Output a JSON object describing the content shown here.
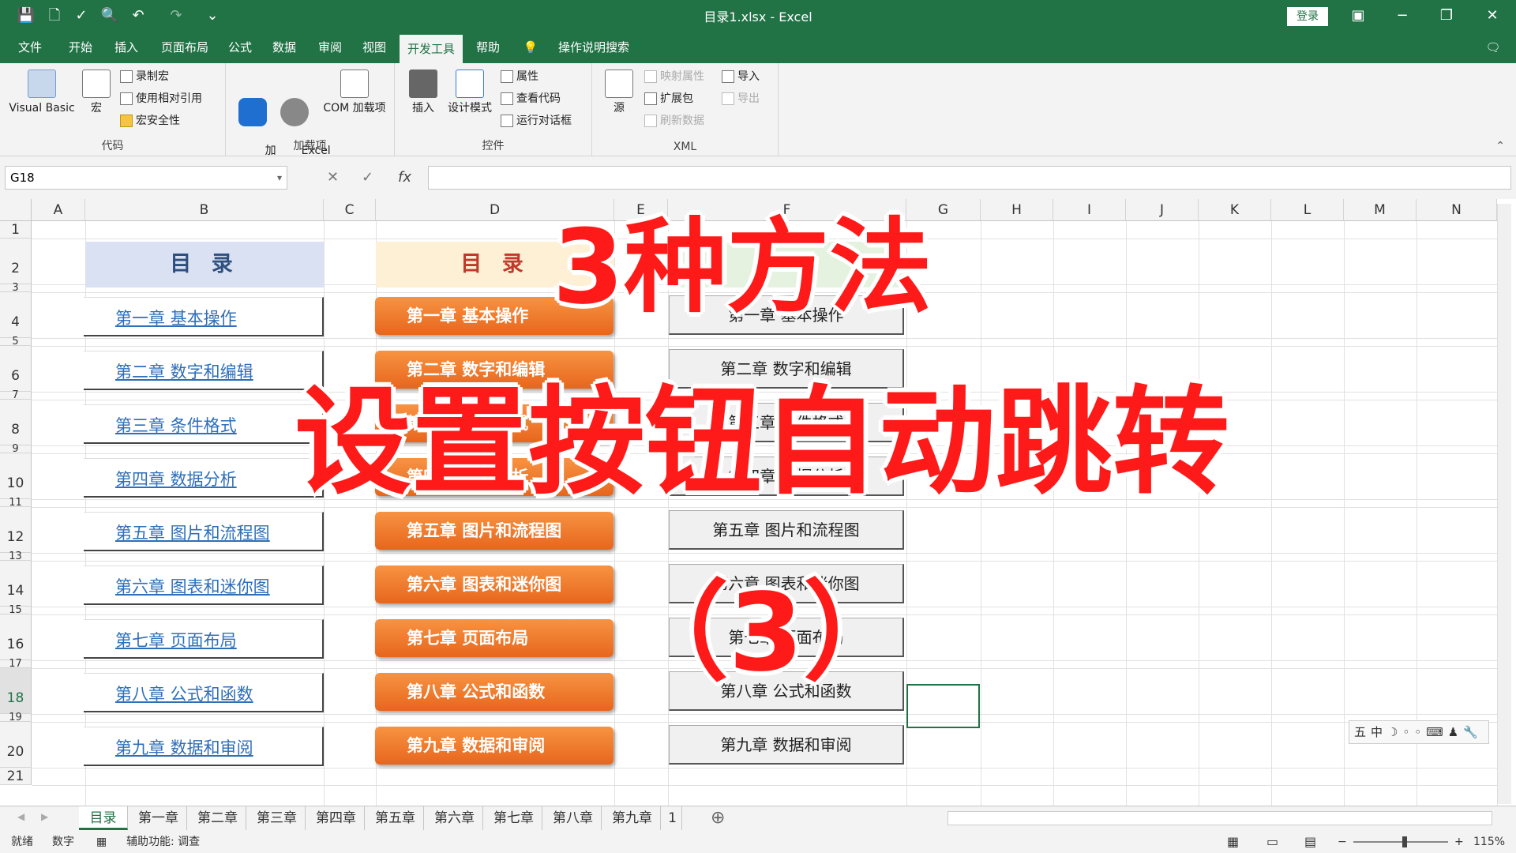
{
  "window": {
    "title": "目录1.xlsx - Excel",
    "login": "登录",
    "min": "−",
    "restore": "❐",
    "close": "✕",
    "ribbon_display": "▣"
  },
  "quick_access": [
    "💾",
    "🗋",
    "✓",
    "🔍",
    "↶",
    "↷",
    "⌄"
  ],
  "menu": {
    "file": "文件",
    "home": "开始",
    "insert": "插入",
    "layout": "页面布局",
    "formula": "公式",
    "data": "数据",
    "review": "审阅",
    "view": "视图",
    "developer": "开发工具",
    "help": "帮助",
    "search": "操作说明搜索"
  },
  "ribbon": {
    "code": {
      "label": "代码",
      "vb": "Visual Basic",
      "macro": "宏",
      "record": "录制宏",
      "relative": "使用相对引用",
      "security": "宏安全性"
    },
    "addins": {
      "label": "加载项",
      "add": "加\n载项",
      "excel": "Excel\n加载项",
      "com": "COM 加载项"
    },
    "controls": {
      "label": "控件",
      "insert": "插入",
      "design": "设计模式",
      "props": "属性",
      "viewcode": "查看代码",
      "dialog": "运行对话框"
    },
    "xml": {
      "label": "XML",
      "source": "源",
      "map": "映射属性",
      "ext": "扩展包",
      "refresh": "刷新数据",
      "import": "导入",
      "export": "导出"
    }
  },
  "formula_bar": {
    "namebox": "G18",
    "cancel": "✕",
    "enter": "✓",
    "fx": "fx",
    "value": ""
  },
  "columns": [
    "A",
    "B",
    "C",
    "D",
    "E",
    "F",
    "G",
    "H",
    "I",
    "J",
    "K",
    "L",
    "M",
    "N"
  ],
  "rows": [
    "1",
    "2",
    "3",
    "4",
    "5",
    "6",
    "7",
    "8",
    "9",
    "10",
    "11",
    "12",
    "13",
    "14",
    "15",
    "16",
    "17",
    "18",
    "19",
    "20",
    "21"
  ],
  "sheet": {
    "header_b": "目 录",
    "header_d": "目 录",
    "links": [
      "第一章  基本操作",
      "第二章  数字和编辑",
      "第三章  条件格式",
      "第四章  数据分析",
      "第五章  图片和流程图",
      "第六章  图表和迷你图",
      "第七章  页面布局",
      "第八章  公式和函数",
      "第九章  数据和审阅"
    ],
    "orange_buttons": [
      "第一章  基本操作",
      "第二章  数字和编辑",
      "第三章  条件格式",
      "第四章  数据分析",
      "第五章  图片和流程图",
      "第六章  图表和迷你图",
      "第七章  页面布局",
      "第八章  公式和函数",
      "第九章  数据和审阅"
    ],
    "gray_buttons": [
      "第一章  基本操作",
      "第二章  数字和编辑",
      "第三章  条件格式",
      "第四章  数据分析",
      "第五章  图片和流程图",
      "第六章  图表和迷你图",
      "第七章  页面布局",
      "第八章  公式和函数",
      "第九章  数据和审阅"
    ]
  },
  "overlay": {
    "line1": "3种方法",
    "line2": "设置按钮自动跳转",
    "line3": "（3）"
  },
  "ime_bar": "五中☽◦◦⌨♟🔧",
  "tabs": [
    "目录",
    "第一章",
    "第二章",
    "第三章",
    "第四章",
    "第五章",
    "第六章",
    "第七章",
    "第八章",
    "第九章",
    "1"
  ],
  "add_sheet": "⊕",
  "status": {
    "ready": "就绪",
    "num": "数字",
    "accessibility": "辅助功能: 调查",
    "zoom": "115%"
  },
  "colors": {
    "excel_green": "#217346",
    "orange": "#f07d30",
    "overlay_red": "#ff1a1a"
  }
}
